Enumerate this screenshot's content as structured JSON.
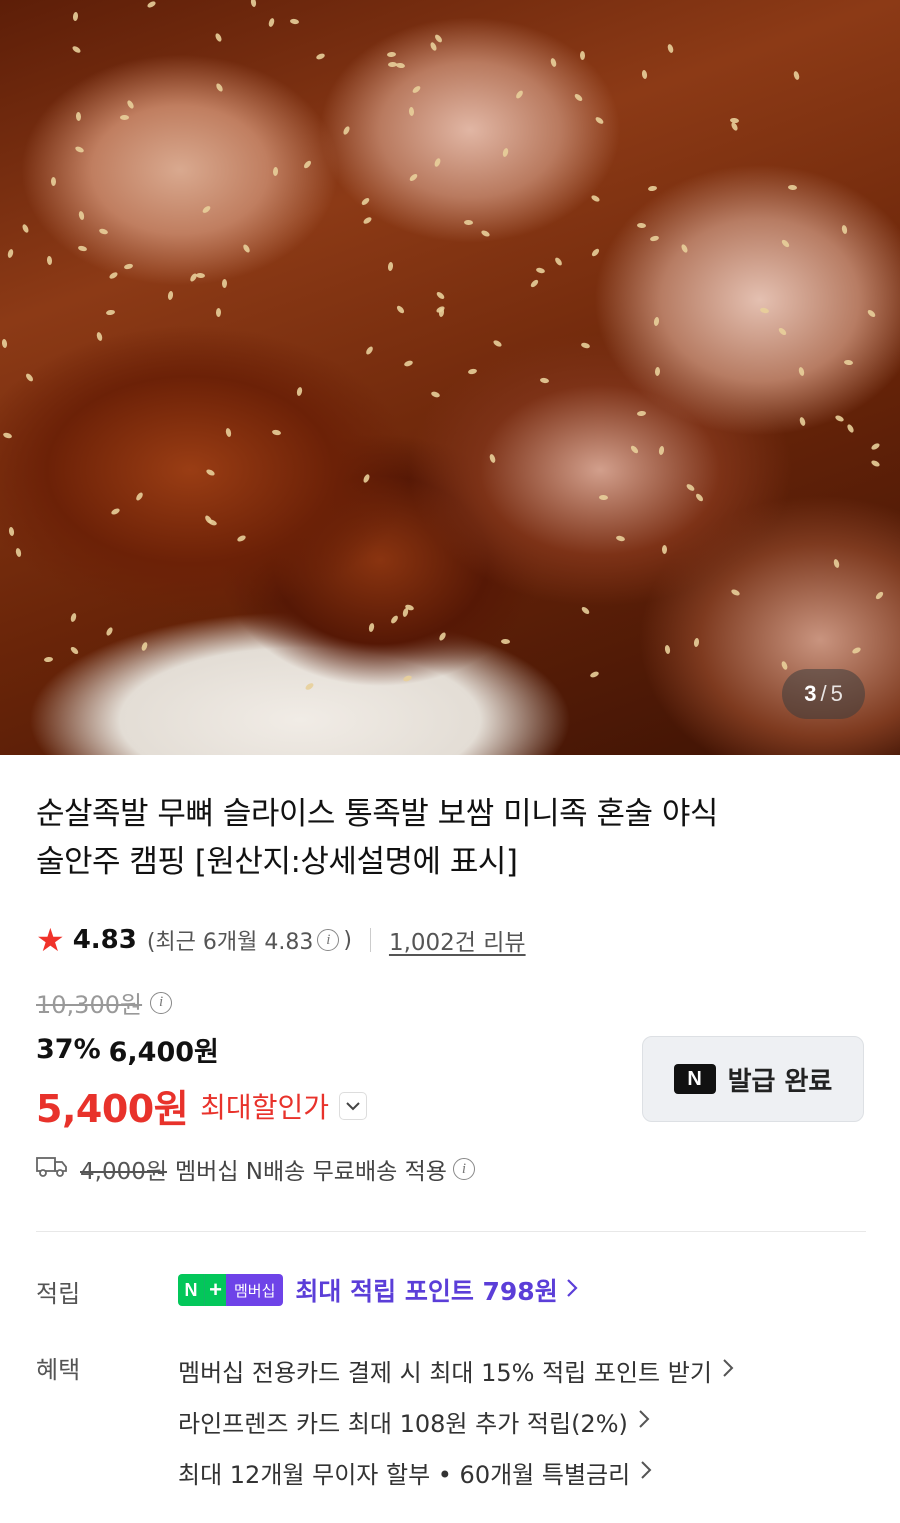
{
  "gallery": {
    "current": "3",
    "separator": "/",
    "total": "5"
  },
  "product": {
    "title_line1": "순살족발 무뼈 슬라이스 통족발 보쌈 미니족 혼술 야식",
    "title_line2": "술안주 캠핑 [원산지:상세설명에 표시]"
  },
  "rating": {
    "score": "4.83",
    "recent_text": "(최근 6개월 4.83",
    "recent_close": ")",
    "review_count": "1,002건 리뷰"
  },
  "price": {
    "original": "10,300원",
    "discount_percent": "37%",
    "discounted": "6,400원",
    "final": "5,400원",
    "final_label": "최대할인가"
  },
  "coupon": {
    "logo": "N",
    "label": "발급 완료"
  },
  "shipping": {
    "fee": "4,000원",
    "text": "멤버십 N배송 무료배송 적용"
  },
  "points": {
    "label": "적립",
    "badge_n": "N",
    "badge_plus": "+",
    "badge_membership": "멤버십",
    "text": "최대 적립 포인트 798원"
  },
  "benefits": {
    "label": "혜택",
    "items": [
      "멤버십 전용카드 결제 시 최대 15% 적립 포인트 받기",
      "라인프렌즈 카드 최대 108원 추가 적립(2%)",
      "최대 12개월 무이자 할부 • 60개월 특별금리"
    ]
  },
  "icons": {
    "star": "star-icon",
    "info": "info-icon",
    "truck": "truck-icon",
    "chevron": "chevron-right-icon",
    "dropdown": "chevron-down-icon"
  },
  "colors": {
    "accent_red": "#e8322b",
    "membership_purple": "#5b3ed8",
    "naver_green": "#03c75a"
  }
}
